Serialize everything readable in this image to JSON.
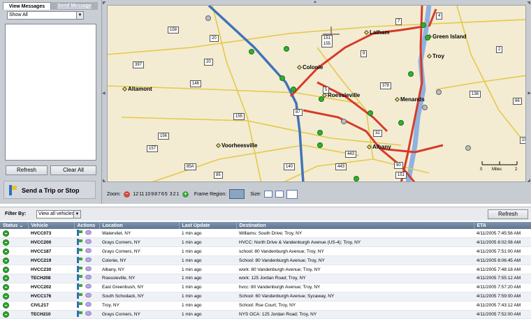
{
  "left_panel": {
    "tabs": [
      {
        "label": "View Messages"
      },
      {
        "label": "Send Message"
      }
    ],
    "filter_value": "Show All",
    "refresh_label": "Refresh",
    "clear_all_label": "Clear All",
    "send_trip_label": "Send a Trip or Stop"
  },
  "map": {
    "places": [
      "Latham",
      "Green Island",
      "Troy",
      "Colonie",
      "Altamont",
      "Roessleville",
      "Menands",
      "Voorheesville",
      "Albany"
    ],
    "road_shields": [
      "158",
      "397",
      "20",
      "146",
      "155",
      "156",
      "157",
      "85A",
      "85",
      "140",
      "443",
      "151",
      "378",
      "136",
      "66",
      "2",
      "7",
      "4",
      "5",
      "9",
      "32",
      "87",
      "90",
      "20",
      "151",
      "151\n155",
      "443"
    ],
    "scale_label": "Miles",
    "scale_ticks": [
      "0",
      "1",
      "2"
    ],
    "toolbar": {
      "zoom_label": "Zoom:",
      "zoom_levels": [
        "12",
        "11",
        "10",
        "9",
        "8",
        "7",
        "6",
        "5",
        "3",
        "2",
        "1"
      ],
      "frame_region_label": "Frame Region:",
      "size_label": "Size:"
    }
  },
  "filter": {
    "label": "Filter By:",
    "value": "View all vehicles",
    "refresh_label": "Refresh"
  },
  "table": {
    "columns": [
      "Status",
      "Vehicle",
      "Actions",
      "Location",
      "Last Update",
      "Destination",
      "ETA"
    ],
    "rows": [
      {
        "vehicle": "HVCC073",
        "location": "Watervliet, NY",
        "last_update": "1 min ago",
        "destination": "Williams: South Drive; Troy, NY",
        "eta": "4/11/2005 7:45:56 AM"
      },
      {
        "vehicle": "HVCC200",
        "location": "Grays Corners, NY",
        "last_update": "1 min ago",
        "destination": "HVCC: North Drive & Vandenburgh Avenue (US-4); Troy, NY",
        "eta": "4/11/2005 8:02:08 AM"
      },
      {
        "vehicle": "HVCC187",
        "location": "Grays Corners, NY",
        "last_update": "1 min ago",
        "destination": "school: 80 Vandenburgh Avenue; Troy, NY",
        "eta": "4/11/2005 7:51:00 AM"
      },
      {
        "vehicle": "HVCC219",
        "location": "Colonie, NY",
        "last_update": "1 min ago",
        "destination": "School: 80 Vandenburgh Avenue; Troy, NY",
        "eta": "4/11/2005 8:06:45 AM"
      },
      {
        "vehicle": "HVCC230",
        "location": "Albany, NY",
        "last_update": "1 min ago",
        "destination": "work: 80 Vandenburgh Avenue; Troy, NY",
        "eta": "4/11/2005 7:48:18 AM"
      },
      {
        "vehicle": "TECH208",
        "location": "Roessleville, NY",
        "last_update": "1 min ago",
        "destination": "work: 125 Jordan Road; Troy, NY",
        "eta": "4/11/2005 7:55:12 AM"
      },
      {
        "vehicle": "HVCC202",
        "location": "East Greenbush, NY",
        "last_update": "1 min ago",
        "destination": "hvcc: 80 Vandenburgh Avenue; Troy, NY",
        "eta": "4/11/2005 7:57:20 AM"
      },
      {
        "vehicle": "HVCC176",
        "location": "South Schodack, NY",
        "last_update": "1 min ago",
        "destination": "School: 60 Vandenburgh Avenue; Sycaway, NY",
        "eta": "4/11/2005 7:59:00 AM"
      },
      {
        "vehicle": "CIVL217",
        "location": "Troy, NY",
        "last_update": "1 min ago",
        "destination": "School: Rse Court; Troy, NY",
        "eta": "4/11/2005 7:43:12 AM"
      },
      {
        "vehicle": "TECH210",
        "location": "Grays Corners, NY",
        "last_update": "1 min ago",
        "destination": "NYS OCA: 125 Jordan Road; Troy, NY",
        "eta": "4/11/2005 7:52:00 AM"
      }
    ]
  },
  "colors": {
    "status_ok": "#2fa82f",
    "header_bg": "#6b809b",
    "map_bg": "#f3ecd2",
    "highway": "#d63a2a",
    "interstate": "#3f74b8"
  }
}
